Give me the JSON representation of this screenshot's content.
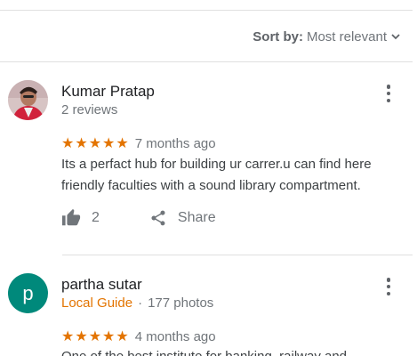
{
  "sort": {
    "label": "Sort by:",
    "value": "Most relevant"
  },
  "reviews": [
    {
      "author": "Kumar Pratap",
      "meta": "2 reviews",
      "stars": "★★★★★",
      "rating": 5,
      "date": "7 months ago",
      "text": "Its a perfact hub for building ur carrer.u can find here friendly faculties with a sound library compartment.",
      "likes": "2",
      "share_label": "Share"
    },
    {
      "author": "partha sutar",
      "avatar_letter": "p",
      "guide_label": "Local Guide",
      "dot": "·",
      "photos": "177 photos",
      "stars": "★★★★★",
      "rating": 5,
      "date": "4 months ago",
      "text": "One of the best institute for banking, railway and"
    }
  ],
  "colors": {
    "star": "#e37400",
    "avatar_p": "#00897b",
    "local_guide": "#e37400"
  }
}
